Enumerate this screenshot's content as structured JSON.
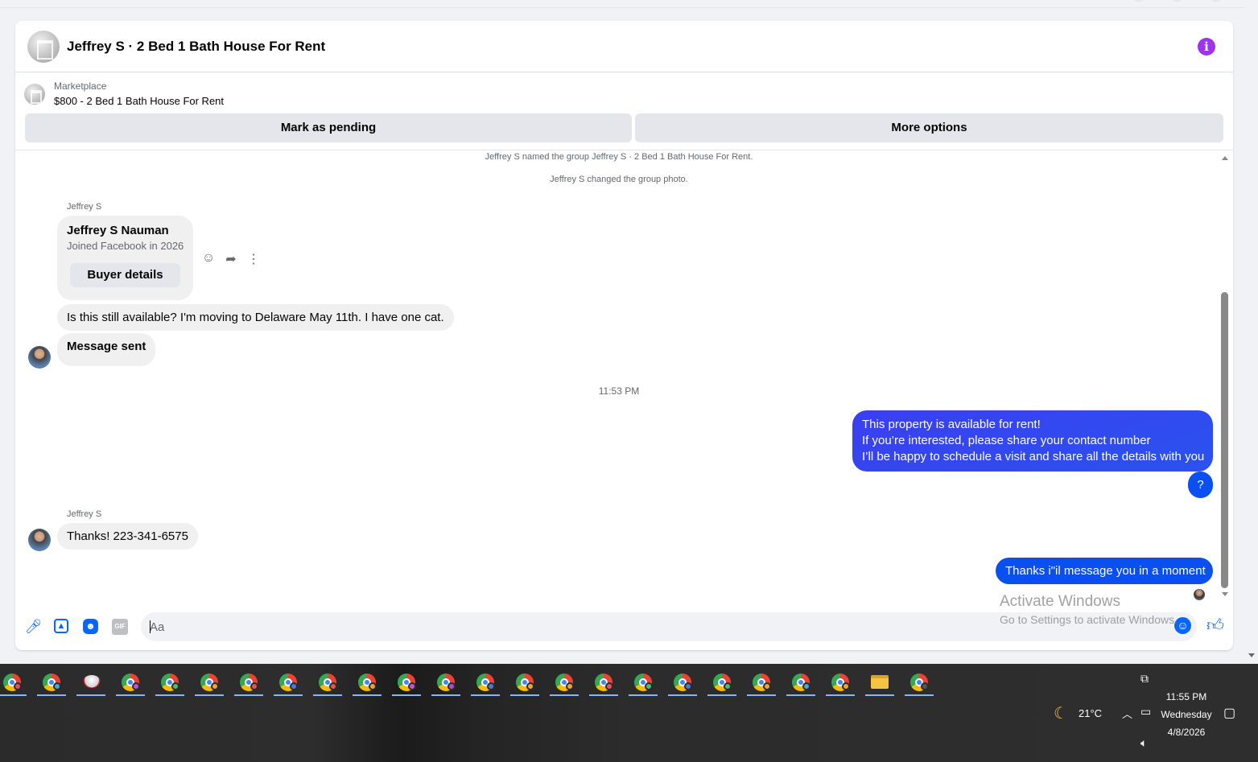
{
  "header": {
    "title": "Jeffrey S · 2 Bed 1 Bath House For Rent",
    "info_icon": "info-icon"
  },
  "marketplace": {
    "label": "Marketplace",
    "listing": "$800 - 2 Bed 1 Bath House For Rent",
    "mark_pending": "Mark as pending",
    "more_options": "More options"
  },
  "conversation": {
    "system_1": "Jeffrey S named the group Jeffrey S · 2 Bed 1 Bath House For Rent.",
    "system_2": "Jeffrey S changed the group photo.",
    "sender_1": "Jeffrey S",
    "profile": {
      "name": "Jeffrey S Nauman",
      "joined": "Joined Facebook in 2026",
      "button": "Buyer details"
    },
    "msg_in_1": "Is this still available? I'm moving  to Delaware May 11th. I have one cat.",
    "msg_in_2": "Message sent",
    "timestamp": "11:53 PM",
    "msg_out_1": {
      "line1": "This property is available for rent!",
      "line2": "If you’re interested, please share your contact number",
      "line3": "I’ll be happy to schedule a visit and share all the details with you"
    },
    "msg_out_2": "?",
    "sender_2": "Jeffrey S",
    "msg_in_3": "Thanks! 223-341-6575",
    "msg_out_3": "Thanks i\"il message you in a moment"
  },
  "composer": {
    "placeholder": "Aa",
    "gif_label": "GIF"
  },
  "watermark": {
    "line1": "Activate Windows",
    "line2": "Go to Settings to activate Windows."
  },
  "taskbar": {
    "apps": [
      {
        "type": "chrome",
        "badge": "#e8505b"
      },
      {
        "type": "chrome",
        "badge": "#4aa8d8"
      },
      {
        "type": "cloud",
        "badge": ""
      },
      {
        "type": "chrome",
        "badge": "#d04ad8"
      },
      {
        "type": "chrome",
        "badge": "#48c06a"
      },
      {
        "type": "chrome",
        "badge": "#f0a33a"
      },
      {
        "type": "chrome",
        "badge": "#e8505b"
      },
      {
        "type": "chrome",
        "badge": "#4a7ad8"
      },
      {
        "type": "chrome",
        "badge": "#e8505b"
      },
      {
        "type": "chrome",
        "badge": "#f0a33a"
      },
      {
        "type": "chrome",
        "badge": "#d04ad8"
      },
      {
        "type": "chrome",
        "badge": "#b04ad8"
      },
      {
        "type": "chrome",
        "badge": "#4a7ad8"
      },
      {
        "type": "chrome",
        "badge": "#f0a33a"
      },
      {
        "type": "chrome",
        "badge": "#f0a33a"
      },
      {
        "type": "chrome",
        "badge": "#e8505b"
      },
      {
        "type": "chrome",
        "badge": "#48c06a"
      },
      {
        "type": "chrome",
        "badge": "#4a7ad8"
      },
      {
        "type": "chrome",
        "badge": "#48c06a"
      },
      {
        "type": "chrome",
        "badge": "#f0a33a"
      },
      {
        "type": "chrome",
        "badge": "#4aa8d8"
      },
      {
        "type": "chrome",
        "badge": "#f0a33a"
      },
      {
        "type": "folder",
        "badge": ""
      },
      {
        "type": "chrome",
        "badge": "#555555"
      }
    ],
    "weather": "21°C",
    "time": "11:55 PM",
    "day": "Wednesday",
    "date": "4/8/2026"
  },
  "colors": {
    "accent": "#0866ff",
    "bubble_out": "#0a50f0",
    "bubble_in": "#f0f0f0",
    "info": "#a033f0"
  }
}
